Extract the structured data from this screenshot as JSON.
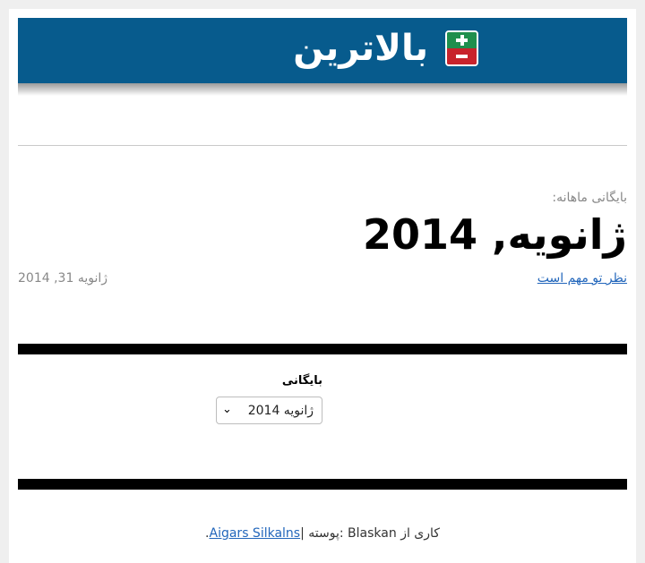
{
  "header": {
    "logo_text": "بالاترین",
    "logo_icon": "plus-minus-icon",
    "colors": {
      "banner": "#075b8d",
      "plus": "#1f8f4d",
      "minus": "#c8232c"
    }
  },
  "archive": {
    "label": "بایگانی ماهانه:",
    "title": "ژانویه, 2014"
  },
  "post": {
    "title": "نظر تو مهم است",
    "date": "ژانویه 31, 2014"
  },
  "widget": {
    "title": "بایگانی",
    "select_value": "ژانویه 2014"
  },
  "footer": {
    "prefix": "| پوسته: Blaskan کاری از ",
    "author": "Aigars Silkalns",
    "suffix": "."
  }
}
